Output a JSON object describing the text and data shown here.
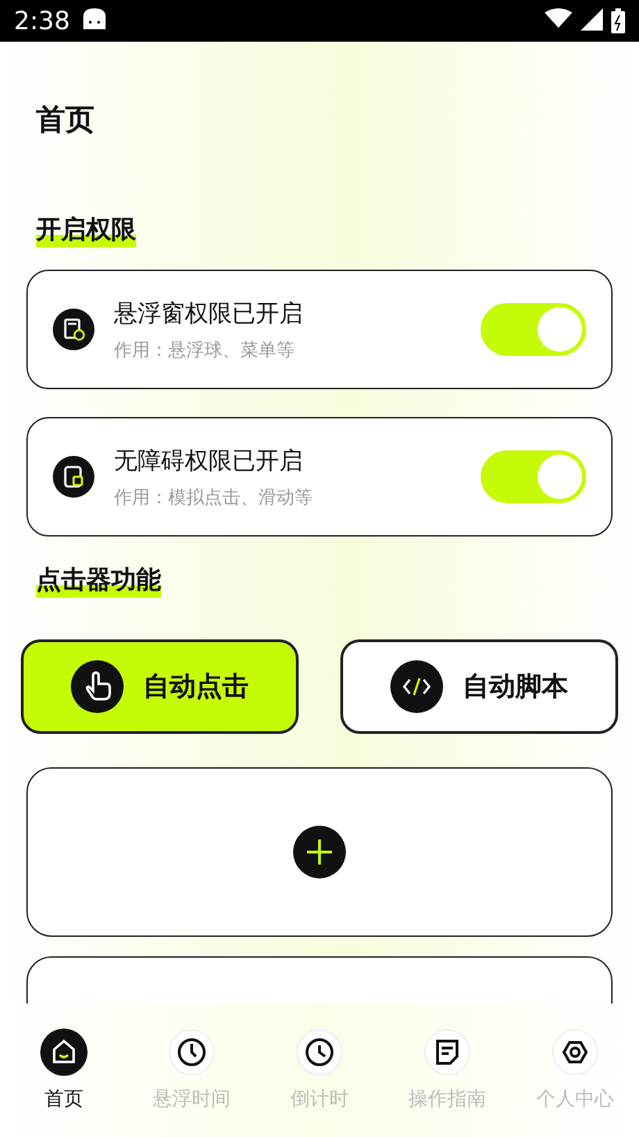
{
  "status_bar": {
    "time": "2:38"
  },
  "title": "首页",
  "permissions": {
    "heading": "开启权限",
    "items": [
      {
        "kind": "window",
        "title": "悬浮窗权限已开启",
        "subtitle": "作用：悬浮球、菜单等",
        "on": true
      },
      {
        "kind": "access",
        "title": "无障碍权限已开启",
        "subtitle": "作用：模拟点击、滑动等",
        "on": true
      }
    ]
  },
  "clicker": {
    "heading": "点击器功能",
    "modes": [
      {
        "kind": "tap",
        "label": "自动点击",
        "selected": true
      },
      {
        "kind": "code",
        "label": "自动脚本",
        "selected": false
      }
    ]
  },
  "nav": [
    {
      "kind": "home",
      "label": "首页",
      "selected": true
    },
    {
      "kind": "timer",
      "label": "悬浮时间",
      "selected": false
    },
    {
      "kind": "clock",
      "label": "倒计时",
      "selected": false
    },
    {
      "kind": "guide",
      "label": "操作指南",
      "selected": false
    },
    {
      "kind": "user",
      "label": "个人中心",
      "selected": false
    }
  ]
}
